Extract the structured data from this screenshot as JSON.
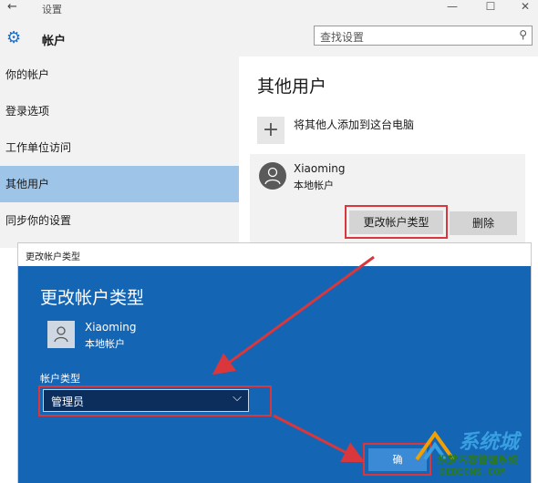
{
  "window": {
    "title": "设置",
    "back_icon": "arrow-left-icon",
    "controls": [
      "—",
      "☐",
      "✕"
    ]
  },
  "header": {
    "icon": "gear-icon",
    "label": "帐户",
    "search_placeholder": "查找设置"
  },
  "sidebar": {
    "items": [
      {
        "label": "你的帐户",
        "active": false
      },
      {
        "label": "登录选项",
        "active": false
      },
      {
        "label": "工作单位访问",
        "active": false
      },
      {
        "label": "其他用户",
        "active": true
      },
      {
        "label": "同步你的设置",
        "active": false
      }
    ]
  },
  "main": {
    "title": "其他用户",
    "add_label": "将其他人添加到这台电脑",
    "user": {
      "name": "Xiaoming",
      "type": "本地帐户"
    },
    "change_button": "更改帐户类型",
    "delete_button": "删除"
  },
  "dialog": {
    "caption": "更改帐户类型",
    "title": "更改帐户类型",
    "user": {
      "name": "Xiaoming",
      "type": "本地帐户"
    },
    "account_type_label": "帐户类型",
    "account_type_value": "管理员",
    "ok_button": "确"
  },
  "watermark": {
    "logo": "系统城",
    "cn": "织梦内容管理系统",
    "url": "DEDECMS.COM"
  },
  "colors": {
    "accent": "#1565b5",
    "active_item": "#9ec5e8",
    "highlight": "#d9373b"
  }
}
